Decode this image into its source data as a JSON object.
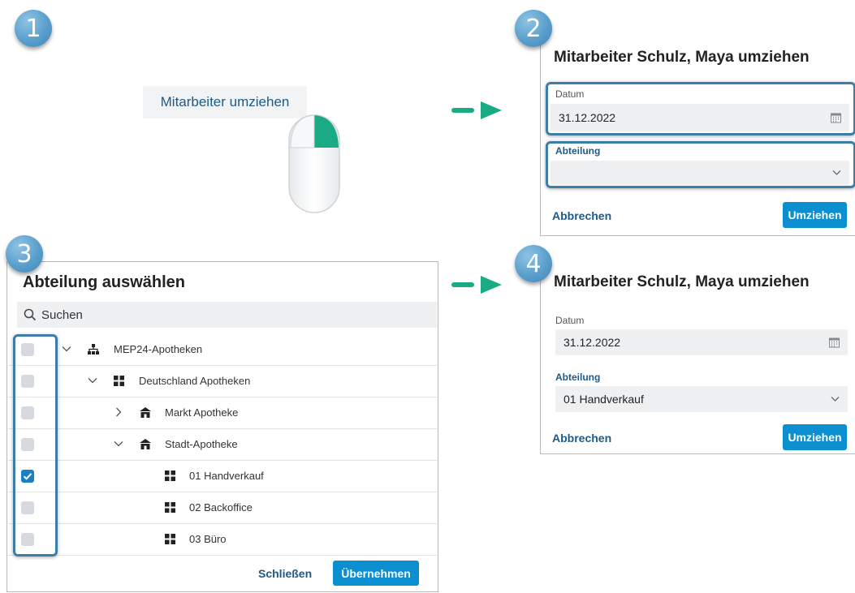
{
  "steps": [
    "1",
    "2",
    "3",
    "4"
  ],
  "step1": {
    "menu_label": "Mitarbeiter umziehen"
  },
  "dialog": {
    "title": "Mitarbeiter Schulz, Maya umziehen",
    "date_label": "Datum",
    "date_value": "31.12.2022",
    "dept_label": "Abteilung",
    "dept_value_empty": "",
    "dept_value_selected": "01 Handverkauf",
    "cancel_label": "Abbrechen",
    "submit_label": "Umziehen"
  },
  "picker": {
    "title": "Abteilung auswählen",
    "search_placeholder": "Suchen",
    "items": [
      {
        "label": "MEP24-Apotheken",
        "icon": "org-tree-icon",
        "checked": false
      },
      {
        "label": "Deutschland Apotheken",
        "icon": "grid-icon",
        "checked": false
      },
      {
        "label": "Markt Apotheke",
        "icon": "store-icon",
        "checked": false
      },
      {
        "label": "Stadt-Apotheke",
        "icon": "store-icon",
        "checked": false
      },
      {
        "label": "01 Handverkauf",
        "icon": "grid-icon",
        "checked": true
      },
      {
        "label": "02 Backoffice",
        "icon": "grid-icon",
        "checked": false
      },
      {
        "label": "03 Büro",
        "icon": "grid-icon",
        "checked": false
      }
    ],
    "close_label": "Schließen",
    "apply_label": "Übernehmen"
  },
  "colors": {
    "accent": "#0b8fd1",
    "link": "#1f5a86",
    "highlight": "#3d7ea8",
    "arrow": "#1aaa84"
  }
}
